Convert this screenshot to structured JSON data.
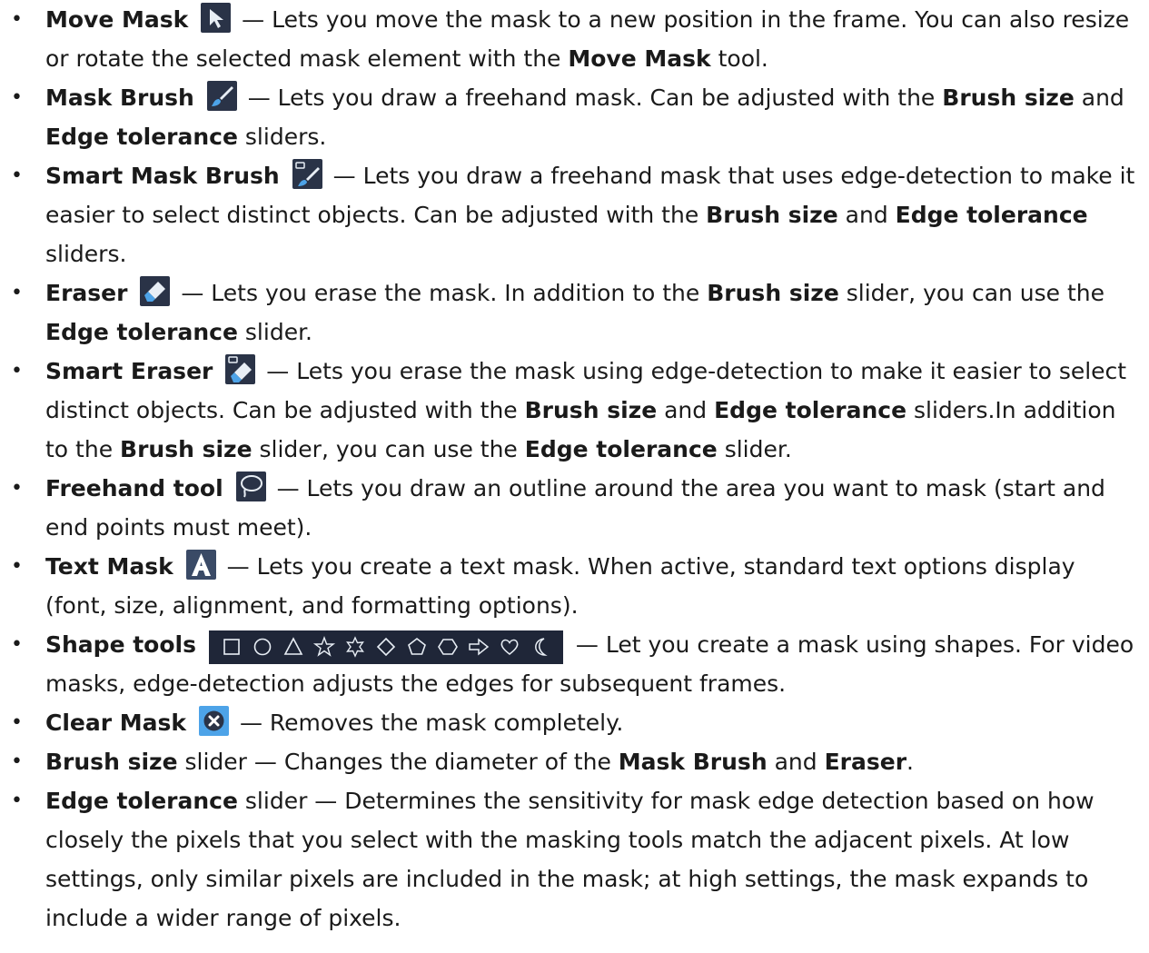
{
  "colors": {
    "icon_bg": "#2a3347",
    "icon_blue": "#4da3e8",
    "text": "#1a1a1a"
  },
  "items": [
    {
      "name": "Move Mask",
      "icon": "move-mask-icon",
      "line1": "— Lets you move the mask to a new position in the frame. You can also resize or rotate the selected mask element with the",
      "b1": "Move Mask",
      "t2": "tool."
    },
    {
      "name": "Mask Brush",
      "icon": "mask-brush-icon",
      "t1": "— Lets you draw a freehand mask. Can be adjusted with the",
      "b1": "Brush size",
      "t2": "and",
      "b2": "Edge tolerance",
      "t3": "sliders."
    },
    {
      "name": "Smart Mask Brush",
      "icon": "smart-mask-brush-icon",
      "t1": "— Lets you draw a freehand mask that uses edge-detection to make it easier to select distinct objects. Can be adjusted with the",
      "b1": "Brush size",
      "t2": "and",
      "b2": "Edge tolerance",
      "t3": "sliders."
    },
    {
      "name": "Eraser",
      "icon": "eraser-icon",
      "t1": "— Lets you erase the mask. In addition to the",
      "b1": "Brush size",
      "t2": "slider, you can use the",
      "b2": "Edge tolerance",
      "t3": "slider."
    },
    {
      "name": "Smart Eraser",
      "icon": "smart-eraser-icon",
      "t1": "— Lets you erase the mask using edge-detection to make it easier to select distinct objects. Can be adjusted with the",
      "b1": "Brush size",
      "t2": "and",
      "b2": "Edge tolerance",
      "t3": "sliders.In addition to the",
      "b3": "Brush size",
      "t4": "slider, you can use the",
      "b4": "Edge tolerance",
      "t5": "slider."
    },
    {
      "name": "Freehand tool",
      "icon": "lasso-icon",
      "t1": "— Lets you draw an outline around the area you want to mask (start and end points must meet)."
    },
    {
      "name": "Text Mask",
      "icon": "text-mask-icon",
      "t1": "— Lets you create a text mask. When active, standard text options display (font, size, alignment, and formatting options)."
    },
    {
      "name": "Shape tools",
      "icons": [
        "rectangle-icon",
        "ellipse-icon",
        "triangle-icon",
        "star-icon",
        "star-6-icon",
        "diamond-icon",
        "pentagon-icon",
        "hexagon-icon",
        "arrow-icon",
        "heart-icon",
        "crescent-icon"
      ],
      "t1": "— Let you create a mask using shapes. For video masks, edge-detection adjusts the edges for subsequent frames."
    },
    {
      "name": "Clear Mask",
      "icon": "clear-mask-icon",
      "t1": "— Removes the mask completely."
    },
    {
      "name": "Brush size",
      "t1": "slider — Changes the diameter of the",
      "b1": "Mask Brush",
      "t2": "and",
      "b2": "Eraser",
      "t3": "."
    },
    {
      "name": "Edge tolerance",
      "t1": "slider — Determines the sensitivity for mask edge detection based on how closely the pixels that you select with the masking tools match the adjacent pixels. At low settings, only similar pixels are included in the mask; at high settings, the mask expands to include a wider range of pixels."
    }
  ]
}
